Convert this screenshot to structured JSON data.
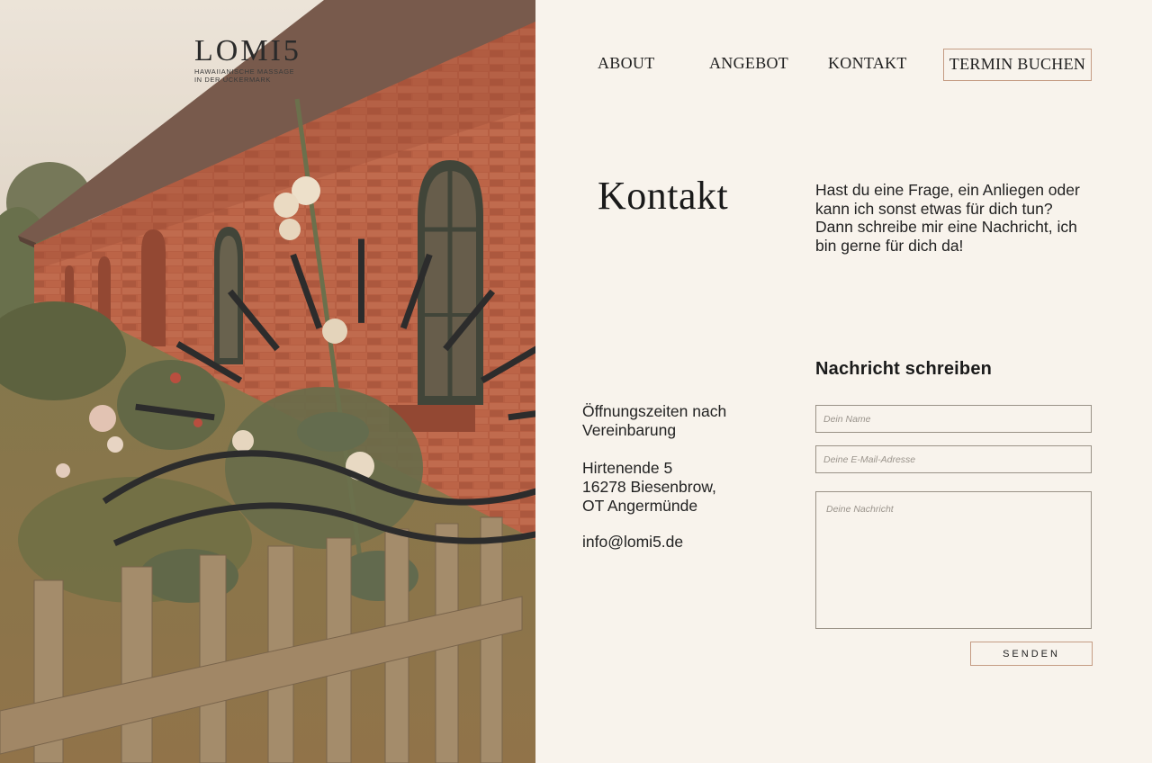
{
  "brand": {
    "name": "LOMI5",
    "tagline_line1": "HAWAIIANISCHE MASSAGE",
    "tagline_line2": "IN DER UCKERMARK"
  },
  "nav": {
    "about": "ABOUT",
    "angebot": "ANGEBOT",
    "kontakt": "KONTAKT",
    "book": "TERMIN BUCHEN"
  },
  "page": {
    "title": "Kontakt",
    "intro": "Hast du eine Frage, ein Anliegen oder kann ich sonst etwas für dich tun? Dann schreibe mir eine Nachricht,  ich bin gerne für dich da!"
  },
  "contact": {
    "hours": "Öffnungszeiten nach Vereinbarung",
    "address": [
      "Hirtenende 5",
      "16278 Biesenbrow,",
      "OT Angermünde"
    ],
    "email": "info@lomi5.de"
  },
  "form": {
    "title": "Nachricht schreiben",
    "name_placeholder": "Dein Name",
    "email_placeholder": "Deine E-Mail-Adresse",
    "message_placeholder": "Deine Nachricht",
    "submit": "SENDEN"
  },
  "colors": {
    "background": "#f8f3ec",
    "accent_border": "#c59c84",
    "brick": "#b5553d"
  }
}
